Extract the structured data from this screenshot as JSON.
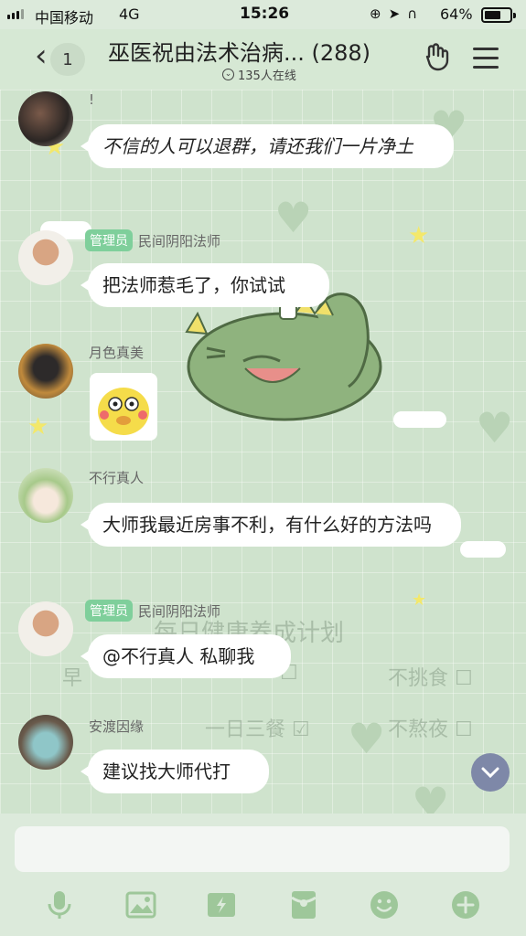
{
  "status_bar": {
    "carrier": "中国移动",
    "network": "4G",
    "time": "15:26",
    "battery_pct": "64%",
    "battery_level": 0.64
  },
  "header": {
    "unread_count": "1",
    "title": "巫医祝由法术治病... (288)",
    "online": "135人在线"
  },
  "messages": [
    {
      "sender": "!",
      "text": "不信的人可以退群，请还我们一片净土",
      "role": ""
    },
    {
      "sender": "民间阴阳法师",
      "role": "管理员",
      "text": "把法师惹毛了，你试试"
    },
    {
      "sender": "月色真美",
      "role": "",
      "text": ""
    },
    {
      "sender": "不行真人",
      "role": "",
      "text": "大师我最近房事不利，有什么好的方法吗"
    },
    {
      "sender": "民间阴阳法师",
      "role": "管理员",
      "text": "@不行真人 私聊我"
    },
    {
      "sender": "安渡因缘",
      "role": "",
      "text": "建议找大师代打"
    }
  ],
  "background_watermark": {
    "title": "每日健康养成计划",
    "item_1": "早",
    "item_2": "不挑食",
    "item_3": "一日三餐",
    "item_4": "不熬夜"
  },
  "toolbar": {
    "icons": [
      "microphone-icon",
      "image-icon",
      "flash-icon",
      "red-packet-icon",
      "emoji-icon",
      "plus-icon"
    ]
  },
  "colors": {
    "header_bg": "#d6e8d4",
    "chat_bg": "#cfe3cd",
    "admin_badge": "#7fcf9b",
    "icon_color": "#9ec79a"
  }
}
